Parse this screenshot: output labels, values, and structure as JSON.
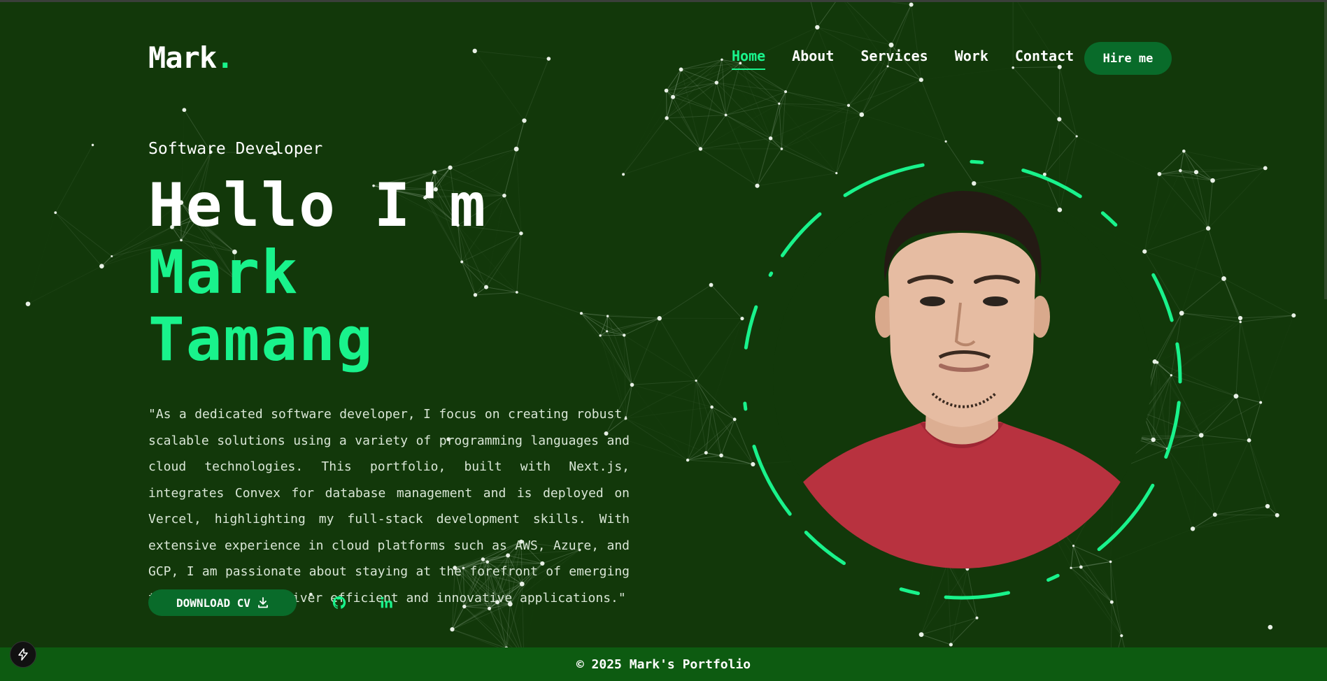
{
  "header": {
    "logo_text": "Mark",
    "logo_dot": ".",
    "nav": [
      "Home",
      "About",
      "Services",
      "Work",
      "Contact"
    ],
    "active_nav": "Home",
    "hire_label": "Hire me"
  },
  "hero": {
    "subtitle": "Software Developer",
    "greeting": "Hello I'm",
    "name_first": "Mark",
    "name_last": "Tamang",
    "bio": "\"As a dedicated software developer, I focus on creating robust, scalable solutions using a variety of programming languages and cloud technologies. This portfolio, built with Next.js, integrates Convex for database management and is deployed on Vercel, highlighting my full-stack development skills. With extensive experience in cloud platforms such as AWS, Azure, and GCP, I am passionate about staying at the forefront of emerging technologies to deliver efficient and innovative applications.\"",
    "download_label": "DOWNLOAD CV",
    "download_icon": "download-icon",
    "socials": [
      {
        "name": "github",
        "icon": "github-icon"
      },
      {
        "name": "linkedin",
        "icon": "linkedin-icon"
      }
    ]
  },
  "footer": {
    "copyright": "© 2025 Mark's Portfolio"
  },
  "colors": {
    "background": "#12380a",
    "accent": "#19f38c",
    "button": "#096b2a",
    "footer": "#0d5b11"
  }
}
